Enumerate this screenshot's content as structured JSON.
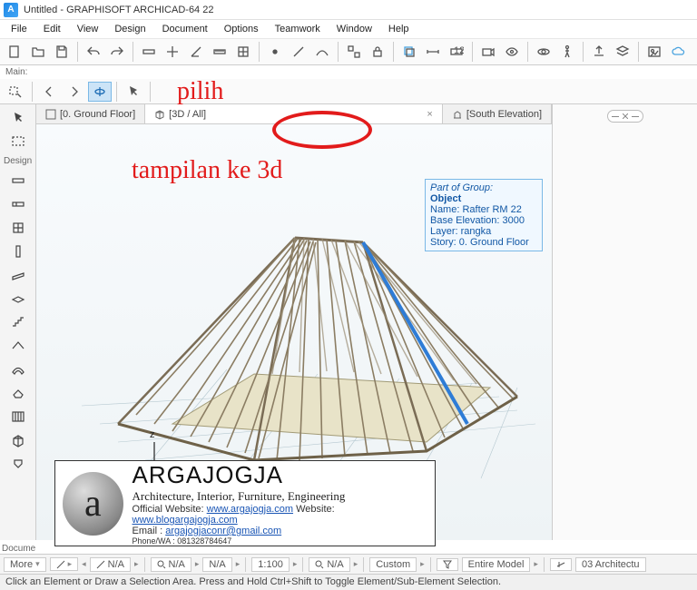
{
  "window": {
    "title": "Untitled - GRAPHISOFT ARCHICAD-64 22"
  },
  "menu": {
    "items": [
      "File",
      "Edit",
      "View",
      "Design",
      "Document",
      "Options",
      "Teamwork",
      "Window",
      "Help"
    ]
  },
  "main_label": "Main:",
  "tabs": {
    "t0": {
      "label": "[0. Ground Floor]"
    },
    "t1": {
      "label": "[3D / All]"
    },
    "t2": {
      "label": "[South Elevation]"
    }
  },
  "left": {
    "design_header": "Design"
  },
  "annot": {
    "pilih": "pilih",
    "tampilan": "tampilan ke 3d"
  },
  "tooltip": {
    "header": "Part of Group:",
    "object": "Object",
    "l1": "Name: Rafter RM 22",
    "l2": "Base Elevation: 3000",
    "l3": "Layer: rangka",
    "l4": "Story: 0. Ground Floor"
  },
  "watermark": {
    "brand": "ARGAJOGJA",
    "tagline": "Architecture, Interior, Furniture, Engineering",
    "w1a": "Official Website: ",
    "w1b": "www.argajogja.com",
    "w1c": " Website: ",
    "w1d": "www.blogargajogja.com",
    "e1a": "Email : ",
    "e1b": "argajogjaconr@gmail.com",
    "p1": "Phone/WA : 081328784647"
  },
  "bottom": {
    "more": "More",
    "na": "N/A",
    "scale": "1:100",
    "cust": "Custom",
    "entire": "Entire Model",
    "arch": "03 Architectu"
  },
  "status": {
    "msg": "Click an Element or Draw a Selection Area. Press and Hold Ctrl+Shift to Toggle Element/Sub-Element Selection."
  },
  "docume": "Docume"
}
